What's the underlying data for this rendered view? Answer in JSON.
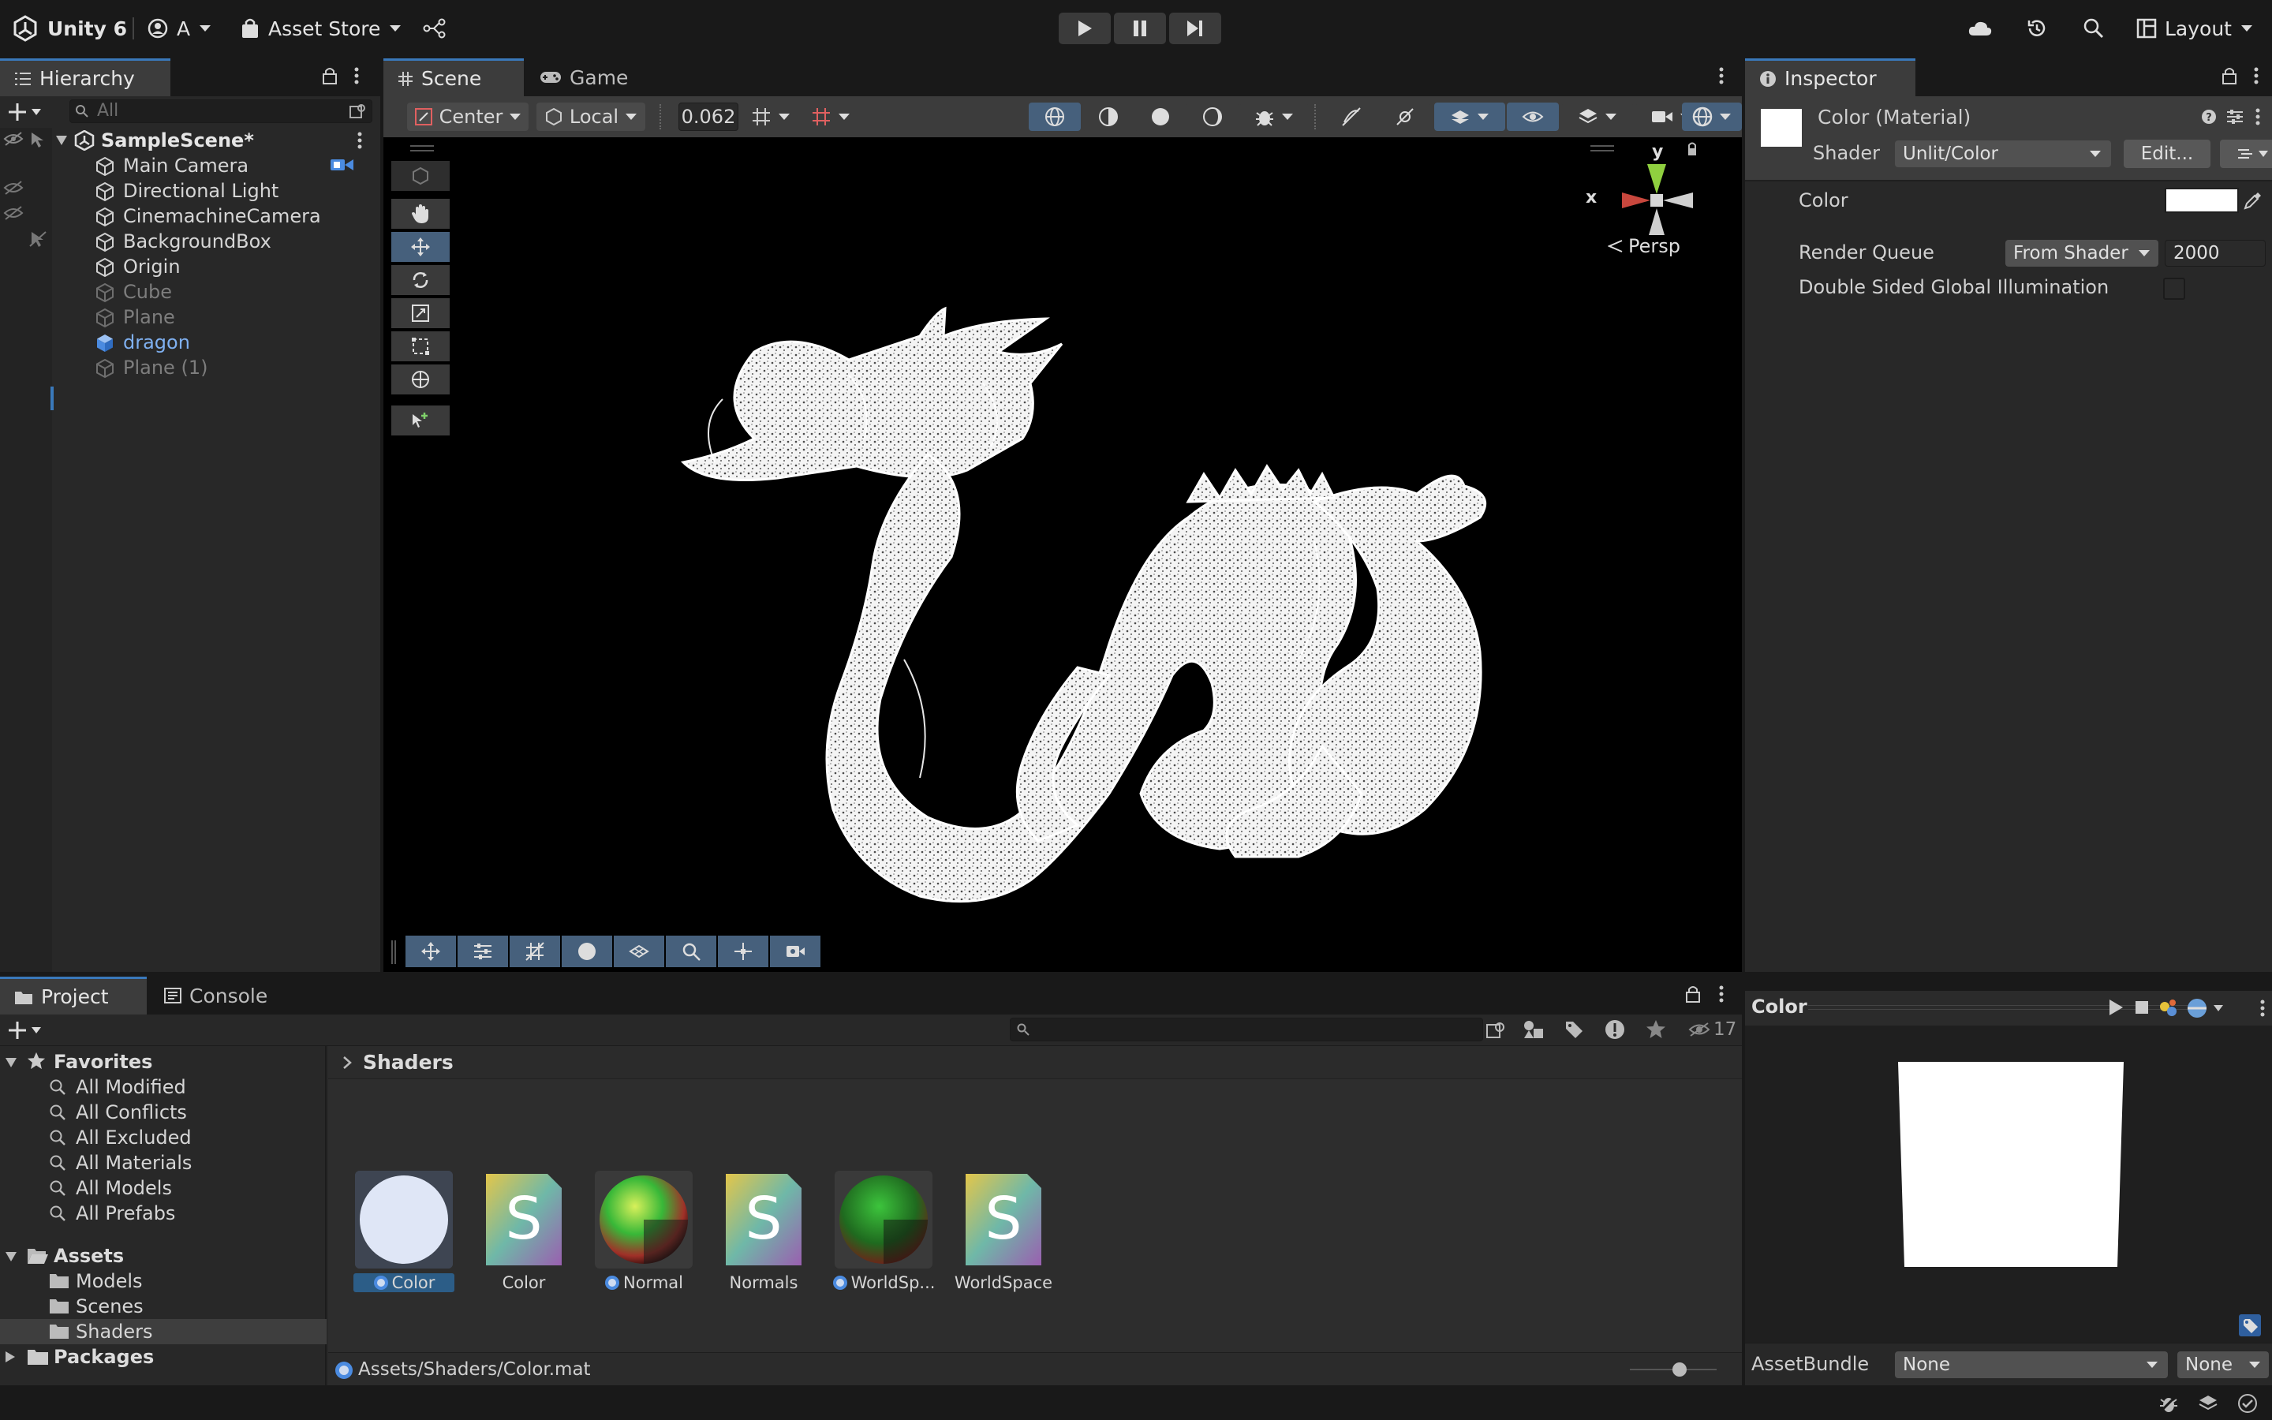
{
  "topbar": {
    "app_name": "Unity 6",
    "account": "A",
    "asset_store": "Asset Store",
    "layout": "Layout"
  },
  "hierarchy": {
    "tab": "Hierarchy",
    "search_placeholder": "All",
    "scene_name": "SampleScene*",
    "items": [
      {
        "label": "Main Camera",
        "state": "normal"
      },
      {
        "label": "Directional Light",
        "state": "normal"
      },
      {
        "label": "CinemachineCamera",
        "state": "normal"
      },
      {
        "label": "BackgroundBox",
        "state": "normal"
      },
      {
        "label": "Origin",
        "state": "normal"
      },
      {
        "label": "Cube",
        "state": "disabled"
      },
      {
        "label": "Plane",
        "state": "disabled"
      },
      {
        "label": "dragon",
        "state": "selected"
      },
      {
        "label": "Plane (1)",
        "state": "disabled"
      }
    ]
  },
  "scene": {
    "tab_scene": "Scene",
    "tab_game": "Game",
    "pivot": "Center",
    "space": "Local",
    "snap_value": "0.062",
    "persp_label": "Persp",
    "gizmo_x": "x",
    "gizmo_y": "y"
  },
  "inspector": {
    "tab": "Inspector",
    "material_title": "Color (Material)",
    "shader_label": "Shader",
    "shader_value": "Unlit/Color",
    "edit_button": "Edit...",
    "color_label": "Color",
    "render_queue_label": "Render Queue",
    "render_queue_mode": "From Shader",
    "render_queue_value": "2000",
    "double_sided_label": "Double Sided Global Illumination",
    "preview_title": "Color",
    "assetbundle_label": "AssetBundle",
    "assetbundle_value": "None",
    "assetbundle_variant": "None"
  },
  "project": {
    "tab_project": "Project",
    "tab_console": "Console",
    "hidden_count": "17",
    "favorites_label": "Favorites",
    "favorites": [
      "All Modified",
      "All Conflicts",
      "All Excluded",
      "All Materials",
      "All Models",
      "All Prefabs"
    ],
    "assets_label": "Assets",
    "asset_folders": [
      "Models",
      "Scenes",
      "Shaders"
    ],
    "packages_label": "Packages",
    "breadcrumb": "Shaders",
    "assets": [
      {
        "label": "Color",
        "kind": "material-white"
      },
      {
        "label": "Color",
        "kind": "shader"
      },
      {
        "label": "Normal",
        "kind": "material-normal"
      },
      {
        "label": "Normals",
        "kind": "shader"
      },
      {
        "label": "WorldSp...",
        "kind": "material-world"
      },
      {
        "label": "WorldSpace",
        "kind": "shader"
      }
    ],
    "selected_path": "Assets/Shaders/Color.mat"
  },
  "colors": {
    "accent": "#3a79bb",
    "selection": "#2c5d87",
    "panel": "#282828",
    "background": "#191919"
  }
}
